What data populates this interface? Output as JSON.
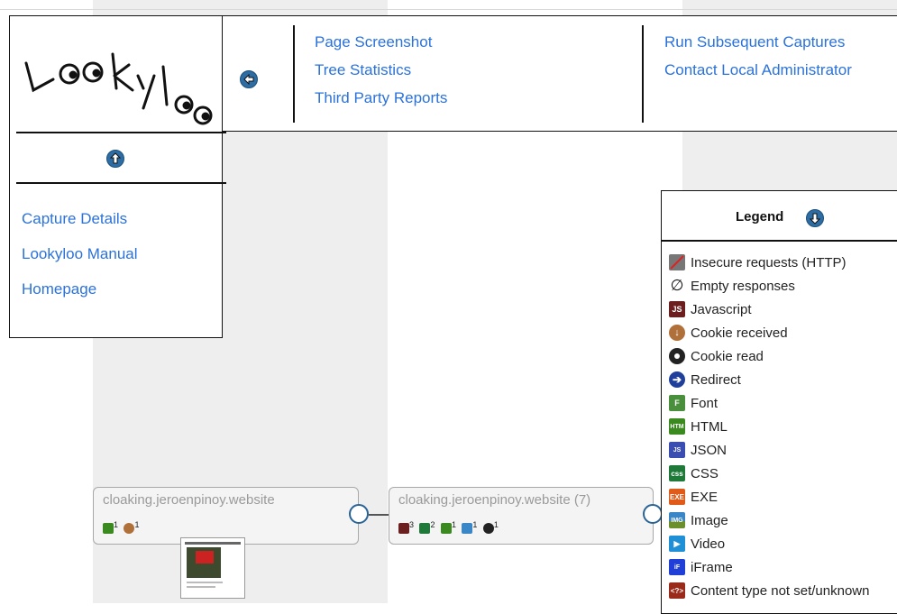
{
  "header": {
    "logo_text": "Lookyloo",
    "links_col1": [
      "Page Screenshot",
      "Tree Statistics",
      "Third Party Reports"
    ],
    "links_col2": [
      "Run Subsequent Captures",
      "Contact Local Administrator"
    ]
  },
  "menu": {
    "links": [
      "Capture Details",
      "Lookyloo Manual",
      "Homepage"
    ]
  },
  "tree": {
    "node1": {
      "title": "cloaking.jeroenpinoy.website",
      "counts": [
        "1",
        "1"
      ]
    },
    "node2": {
      "title": "cloaking.jeroenpinoy.website (7)",
      "counts": [
        "3",
        "2",
        "1",
        "1",
        "1"
      ]
    }
  },
  "legend": {
    "title": "Legend",
    "items": [
      {
        "label": "Insecure requests (HTTP)",
        "icon": "insecure-lock-icon"
      },
      {
        "label": "Empty responses",
        "icon": "empty-set-icon"
      },
      {
        "label": "Javascript",
        "icon": "javascript-icon"
      },
      {
        "label": "Cookie received",
        "icon": "cookie-received-icon"
      },
      {
        "label": "Cookie read",
        "icon": "cookie-read-icon"
      },
      {
        "label": "Redirect",
        "icon": "redirect-icon"
      },
      {
        "label": "Font",
        "icon": "font-icon"
      },
      {
        "label": "HTML",
        "icon": "html-icon"
      },
      {
        "label": "JSON",
        "icon": "json-icon"
      },
      {
        "label": "CSS",
        "icon": "css-icon"
      },
      {
        "label": "EXE",
        "icon": "exe-icon"
      },
      {
        "label": "Image",
        "icon": "image-icon"
      },
      {
        "label": "Video",
        "icon": "video-icon"
      },
      {
        "label": "iFrame",
        "icon": "iframe-icon"
      },
      {
        "label": "Content type not set/unknown",
        "icon": "unknown-content-icon"
      }
    ]
  },
  "colors": {
    "link": "#2b72d9",
    "button": "#2e6da4",
    "edge_circle": "#2a6496"
  }
}
